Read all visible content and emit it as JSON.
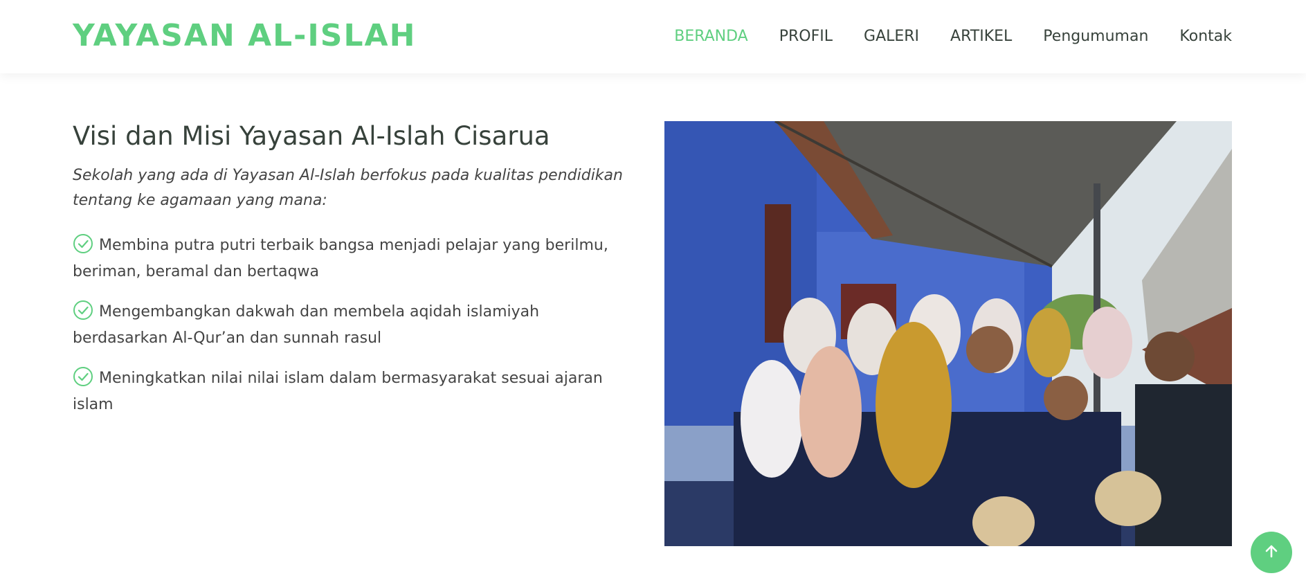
{
  "brand": {
    "logo_text": "YAYASAN AL-ISLAH",
    "accent_color": "#5fcf80",
    "text_color": "#37423b"
  },
  "nav": {
    "items": [
      {
        "label": "BERANDA",
        "active": true
      },
      {
        "label": "PROFIL",
        "active": false
      },
      {
        "label": "GALERI",
        "active": false
      },
      {
        "label": "ARTIKEL",
        "active": false
      },
      {
        "label": "Pengumuman",
        "active": false
      },
      {
        "label": "Kontak",
        "active": false
      }
    ]
  },
  "main": {
    "title": "Visi dan Misi Yayasan Al-Islah Cisarua",
    "lead": "Sekolah yang ada di Yayasan Al-Islah berfokus pada kualitas pendidikan tentang ke agamaan yang mana:",
    "features": [
      "Membina putra putri terbaik bangsa menjadi pelajar yang berilmu, beriman, beramal dan bertaqwa",
      "Mengembangkan dakwah dan membela aqidah islamiyah berdasarkan Al-Qur’an dan sunnah rasul",
      "Meningkatkan nilai nilai islam dalam bermasyarakat sesuai ajaran islam"
    ],
    "feature_icon": "check-circle-icon"
  },
  "photo": {
    "icon": "group-photo"
  },
  "back_to_top": {
    "icon": "arrow-up-icon"
  }
}
